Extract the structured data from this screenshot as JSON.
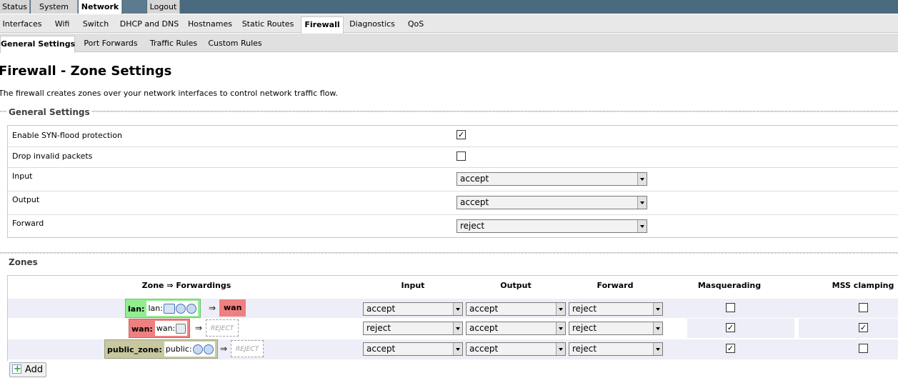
{
  "top_menu": {
    "items": [
      "Status",
      "System",
      "Network",
      "Logout"
    ]
  },
  "network_tabs": [
    "Interfaces",
    "Wifi",
    "Switch",
    "DHCP and DNS",
    "Hostnames",
    "Static Routes",
    "Firewall",
    "Diagnostics",
    "QoS"
  ],
  "firewall_tabs": [
    "General Settings",
    "Port Forwards",
    "Traffic Rules",
    "Custom Rules"
  ],
  "page": {
    "title": "Firewall - Zone Settings",
    "description": "The firewall creates zones over your network interfaces to control network traffic flow."
  },
  "general_settings": {
    "legend": "General Settings",
    "syn_flood": {
      "label": "Enable SYN-flood protection",
      "checked": true
    },
    "drop_invalid": {
      "label": "Drop invalid packets",
      "checked": false
    },
    "input": {
      "label": "Input",
      "value": "accept"
    },
    "output": {
      "label": "Output",
      "value": "accept"
    },
    "forward": {
      "label": "Forward",
      "value": "reject"
    }
  },
  "zones": {
    "legend": "Zones",
    "headers": {
      "zone": "Zone ⇒ Forwardings",
      "input": "Input",
      "output": "Output",
      "forward": "Forward",
      "masq": "Masquerading",
      "mss": "MSS clamping"
    },
    "arrow": "⇒",
    "rows": [
      {
        "name": "lan:",
        "iface": "lan:",
        "forward_to": "wan",
        "input": "accept",
        "output": "accept",
        "forward": "reject",
        "masq": false,
        "mss": false,
        "zone_color": "#90ee90",
        "target_color": "#f08080"
      },
      {
        "name": "wan:",
        "iface": "wan:",
        "forward_to": "REJECT",
        "input": "reject",
        "output": "accept",
        "forward": "reject",
        "masq": true,
        "mss": true,
        "zone_color": "#f08080"
      },
      {
        "name": "public_zone:",
        "iface": "public:",
        "forward_to": "REJECT",
        "input": "accept",
        "output": "accept",
        "forward": "reject",
        "masq": true,
        "mss": false,
        "zone_color": "#c8c8a0"
      }
    ]
  },
  "add_button": {
    "label": "Add"
  },
  "check_mark": "✓"
}
